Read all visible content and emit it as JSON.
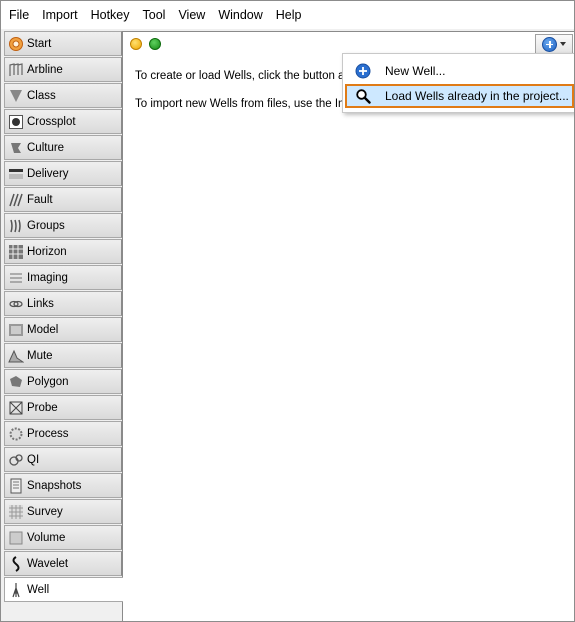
{
  "menubar": {
    "items": [
      "File",
      "Import",
      "Hotkey",
      "Tool",
      "View",
      "Window",
      "Help"
    ]
  },
  "sidebar": {
    "items": [
      {
        "label": "Start",
        "icon": "start-icon"
      },
      {
        "label": "Arbline",
        "icon": "arbline-icon"
      },
      {
        "label": "Class",
        "icon": "class-icon"
      },
      {
        "label": "Crossplot",
        "icon": "crossplot-icon"
      },
      {
        "label": "Culture",
        "icon": "culture-icon"
      },
      {
        "label": "Delivery",
        "icon": "delivery-icon"
      },
      {
        "label": "Fault",
        "icon": "fault-icon"
      },
      {
        "label": "Groups",
        "icon": "groups-icon"
      },
      {
        "label": "Horizon",
        "icon": "horizon-icon"
      },
      {
        "label": "Imaging",
        "icon": "imaging-icon"
      },
      {
        "label": "Links",
        "icon": "links-icon"
      },
      {
        "label": "Model",
        "icon": "model-icon"
      },
      {
        "label": "Mute",
        "icon": "mute-icon"
      },
      {
        "label": "Polygon",
        "icon": "polygon-icon"
      },
      {
        "label": "Probe",
        "icon": "probe-icon"
      },
      {
        "label": "Process",
        "icon": "process-icon"
      },
      {
        "label": "QI",
        "icon": "qi-icon"
      },
      {
        "label": "Snapshots",
        "icon": "snapshots-icon"
      },
      {
        "label": "Survey",
        "icon": "survey-icon"
      },
      {
        "label": "Volume",
        "icon": "volume-icon"
      },
      {
        "label": "Wavelet",
        "icon": "wavelet-icon"
      },
      {
        "label": "Well",
        "icon": "well-icon",
        "active": true
      }
    ]
  },
  "main": {
    "text1": "To create or load Wells, click the button at",
    "text2": "To import new Wells from files, use the Im",
    "add_button": {
      "icon": "plus-circle-icon",
      "caret": "chevron-down-icon"
    }
  },
  "dropdown": {
    "items": [
      {
        "label": "New Well...",
        "icon": "plus-circle-icon"
      },
      {
        "label": "Load Wells already in the project...",
        "icon": "magnifier-icon",
        "highlighted": true
      }
    ],
    "highlight_color": "#cde8ff",
    "outline_color": "#e07b16"
  }
}
